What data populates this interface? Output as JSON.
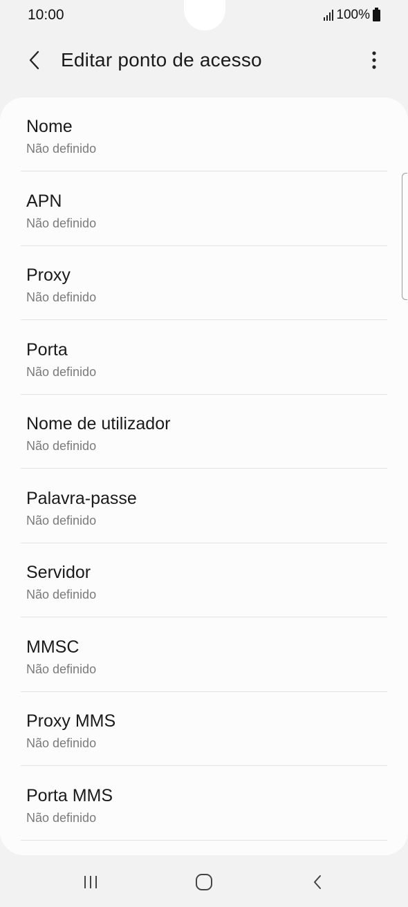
{
  "status_bar": {
    "time": "10:00",
    "battery_percent": "100%"
  },
  "app_bar": {
    "title": "Editar ponto de acesso",
    "back_icon": "chevron-left-icon",
    "more_icon": "more-vertical-icon"
  },
  "settings": {
    "items": [
      {
        "title": "Nome",
        "summary": "Não definido"
      },
      {
        "title": "APN",
        "summary": "Não definido"
      },
      {
        "title": "Proxy",
        "summary": "Não definido"
      },
      {
        "title": "Porta",
        "summary": "Não definido"
      },
      {
        "title": "Nome de utilizador",
        "summary": "Não definido"
      },
      {
        "title": "Palavra-passe",
        "summary": "Não definido"
      },
      {
        "title": "Servidor",
        "summary": "Não definido"
      },
      {
        "title": "MMSC",
        "summary": "Não definido"
      },
      {
        "title": "Proxy MMS",
        "summary": "Não definido"
      },
      {
        "title": "Porta MMS",
        "summary": "Não definido"
      }
    ]
  },
  "nav_bar": {
    "recents_icon": "recents-icon",
    "home_icon": "home-icon",
    "back_icon": "back-icon"
  },
  "colors": {
    "background": "#f2f2f2",
    "card": "#fcfcfc",
    "title_text": "#1a1a1a",
    "summary_text": "#7a7a7a",
    "divider": "#e3e3e3"
  }
}
